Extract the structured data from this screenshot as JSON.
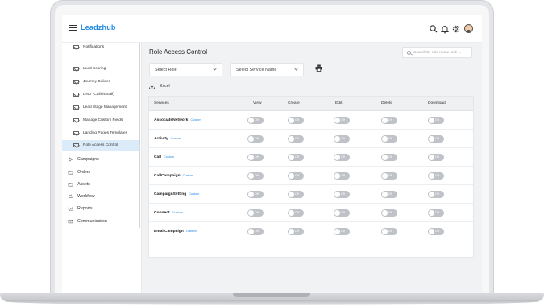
{
  "app": {
    "logo": "Leadzhub"
  },
  "topbar": {
    "icons": [
      "search-icon",
      "bell-icon",
      "gear-icon",
      "avatar"
    ]
  },
  "sidebar": {
    "sub_items": [
      {
        "label": "Notifications",
        "active": false
      },
      {
        "label": "Lead Scoring",
        "active": false
      },
      {
        "label": "Journey Builder",
        "active": false
      },
      {
        "label": "DND (Calls/Email)",
        "active": false
      },
      {
        "label": "Lead Stage Management",
        "active": false
      },
      {
        "label": "Manage Custom Fields",
        "active": false
      },
      {
        "label": "Landing Pages Templates",
        "active": false
      },
      {
        "label": "Role Access Control",
        "active": true
      }
    ],
    "main_items": [
      {
        "label": "Campaigns",
        "icon": "play-icon"
      },
      {
        "label": "Orders",
        "icon": "folder-icon"
      },
      {
        "label": "Assets",
        "icon": "folder-icon"
      },
      {
        "label": "Workflow",
        "icon": "workflow-icon"
      },
      {
        "label": "Reports",
        "icon": "reports-icon"
      },
      {
        "label": "Communication",
        "icon": "mail-icon"
      }
    ]
  },
  "main": {
    "title": "Role Access Control",
    "search_placeholder": "Search by role name and ...",
    "select_role": "Select Role",
    "select_service": "Select Service Name",
    "excel_label": "Excel",
    "columns": [
      "Services",
      "View",
      "Create",
      "Edit",
      "Delete",
      "Download"
    ],
    "toggle_label": "Off",
    "custom_tag": "Custom",
    "rows": [
      {
        "service": "AssociateNetwork",
        "tag": "Custom"
      },
      {
        "service": "Activity",
        "tag": "Custom"
      },
      {
        "service": "Call",
        "tag": "Custom"
      },
      {
        "service": "CallCampaign",
        "tag": "Custom"
      },
      {
        "service": "CampaignSetting",
        "tag": "Custom"
      },
      {
        "service": "Connect",
        "tag": "Custom"
      },
      {
        "service": "EmailCampaign",
        "tag": "Custom"
      }
    ]
  },
  "colors": {
    "accent": "#1e88e5",
    "toggle_off": "#bfc2c7",
    "active_item_bg": "#dcebfa"
  }
}
